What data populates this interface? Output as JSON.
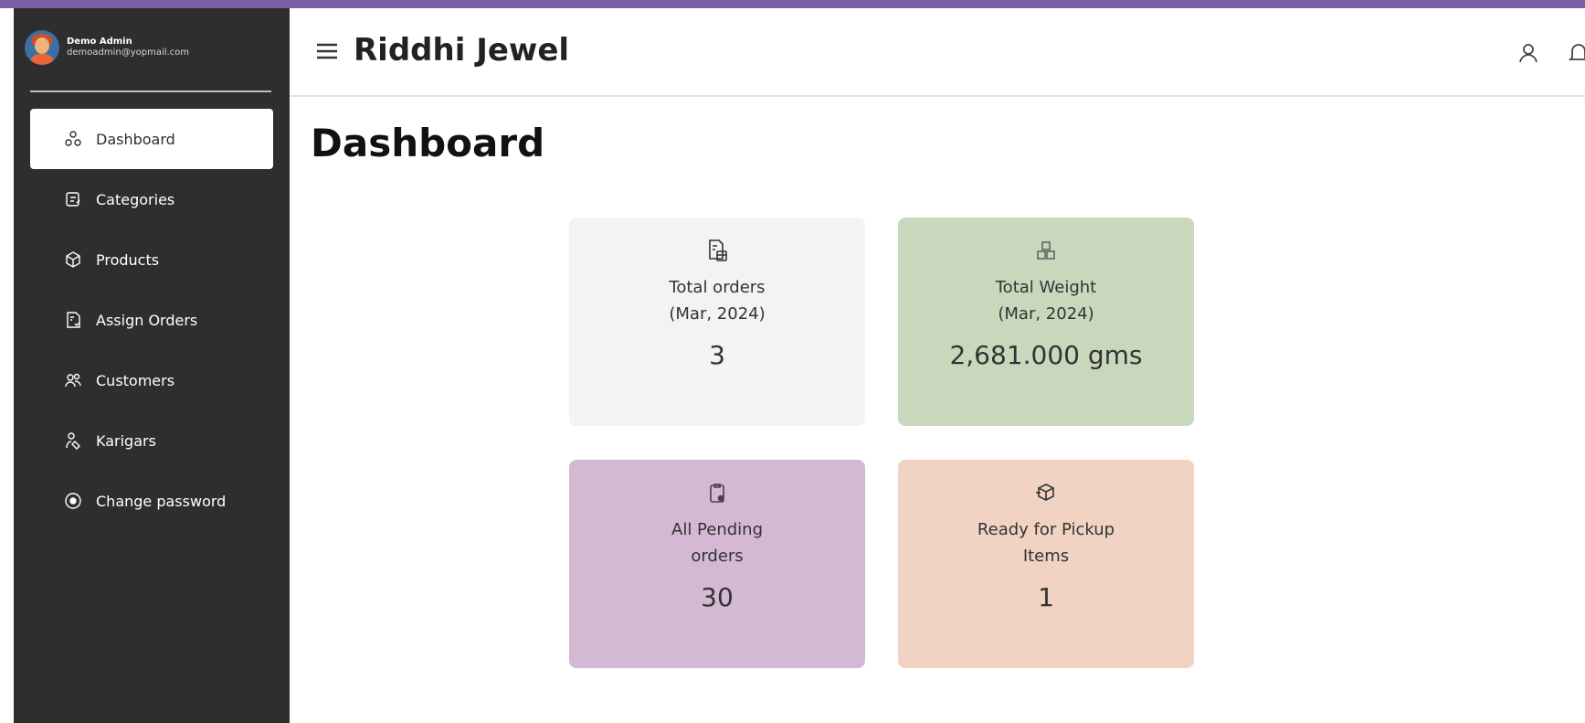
{
  "profile": {
    "name": "Demo Admin",
    "email": "demoadmin@yopmail.com"
  },
  "sidebar": {
    "items": [
      {
        "label": "Dashboard",
        "icon": "dashboard-icon",
        "active": true
      },
      {
        "label": "Categories",
        "icon": "categories-icon",
        "active": false
      },
      {
        "label": "Products",
        "icon": "products-icon",
        "active": false
      },
      {
        "label": "Assign Orders",
        "icon": "assign-orders-icon",
        "active": false
      },
      {
        "label": "Customers",
        "icon": "customers-icon",
        "active": false
      },
      {
        "label": "Karigars",
        "icon": "karigars-icon",
        "active": false
      },
      {
        "label": "Change password",
        "icon": "change-password-icon",
        "active": false
      }
    ]
  },
  "header": {
    "title": "Riddhi Jewel"
  },
  "main": {
    "title": "Dashboard",
    "cards": [
      {
        "label": "Total orders\n(Mar, 2024)",
        "value": "3",
        "icon": "orders-doc-icon",
        "color": "#f3f3f3"
      },
      {
        "label": "Total Weight\n(Mar, 2024)",
        "value": "2,681.000 gms",
        "icon": "weight-blocks-icon",
        "color": "#c8d8bd"
      },
      {
        "label": "All Pending\norders",
        "value": "30",
        "icon": "pending-clipboard-icon",
        "color": "#d4b9d4"
      },
      {
        "label": "Ready for Pickup\nItems",
        "value": "1",
        "icon": "pickup-box-icon",
        "color": "#f0d3c3"
      }
    ]
  },
  "colors": {
    "sidebar_bg": "#2e2e2e",
    "accent_border": "#7b5ea7"
  }
}
